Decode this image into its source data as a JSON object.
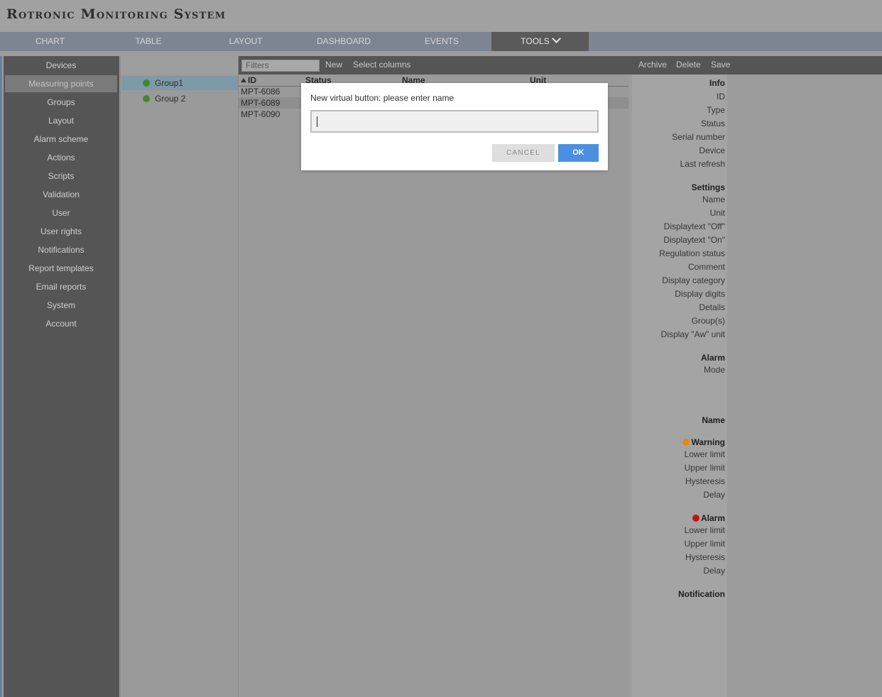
{
  "app": {
    "title": "Rotronic Monitoring System"
  },
  "nav": {
    "tabs": [
      "CHART",
      "TABLE",
      "LAYOUT",
      "DASHBOARD",
      "EVENTS",
      "TOOLS"
    ]
  },
  "sidebar": {
    "items": [
      "Devices",
      "Measuring points",
      "Groups",
      "Layout",
      "Alarm scheme",
      "Actions",
      "Scripts",
      "Validation",
      "User",
      "User rights",
      "Notifications",
      "Report templates",
      "Email reports",
      "System",
      "Account"
    ],
    "active": "Measuring points"
  },
  "groups": {
    "items": [
      {
        "label": "Group1",
        "status_color": "#3f8a2a",
        "selected": true
      },
      {
        "label": "Group 2",
        "status_color": "#3f8a2a",
        "selected": false
      }
    ]
  },
  "table": {
    "filters_placeholder": "Filters",
    "new_label": "New",
    "select_columns_label": "Select columns",
    "columns": [
      "ID",
      "Status",
      "Name",
      "Unit"
    ],
    "rows": [
      {
        "id": "MPT-6086"
      },
      {
        "id": "MPT-6089"
      },
      {
        "id": "MPT-6090"
      }
    ]
  },
  "props": {
    "toolbar": {
      "archive": "Archive",
      "delete": "Delete",
      "save": "Save"
    },
    "info_heading": "Info",
    "info": [
      "ID",
      "Type",
      "Status",
      "Serial number",
      "Device",
      "Last refresh"
    ],
    "settings_heading": "Settings",
    "settings": [
      "Name",
      "Unit",
      "Displaytext \"Off\"",
      "Displaytext \"On\"",
      "Regulation status",
      "Comment",
      "Display category",
      "Display digits",
      "Details",
      "Group(s)",
      "Display \"Aw\" unit"
    ],
    "alarm_heading": "Alarm",
    "alarm_mode": "Mode",
    "name_heading": "Name",
    "warning_heading": "Warning",
    "warning_color": "#e08a12",
    "warning_fields": [
      "Lower limit",
      "Upper limit",
      "Hysteresis",
      "Delay"
    ],
    "alarm2_heading": "Alarm",
    "alarm2_color": "#c01414",
    "alarm_fields": [
      "Lower limit",
      "Upper limit",
      "Hysteresis",
      "Delay"
    ],
    "notification_heading": "Notification"
  },
  "dialog": {
    "prompt": "New virtual button: please enter name",
    "input_value": "",
    "cancel_label": "CANCEL",
    "ok_label": "OK"
  },
  "colors": {
    "accent": "#4a8fe0",
    "sidebar_bg": "#555555",
    "nav_bg": "#7e8592"
  }
}
